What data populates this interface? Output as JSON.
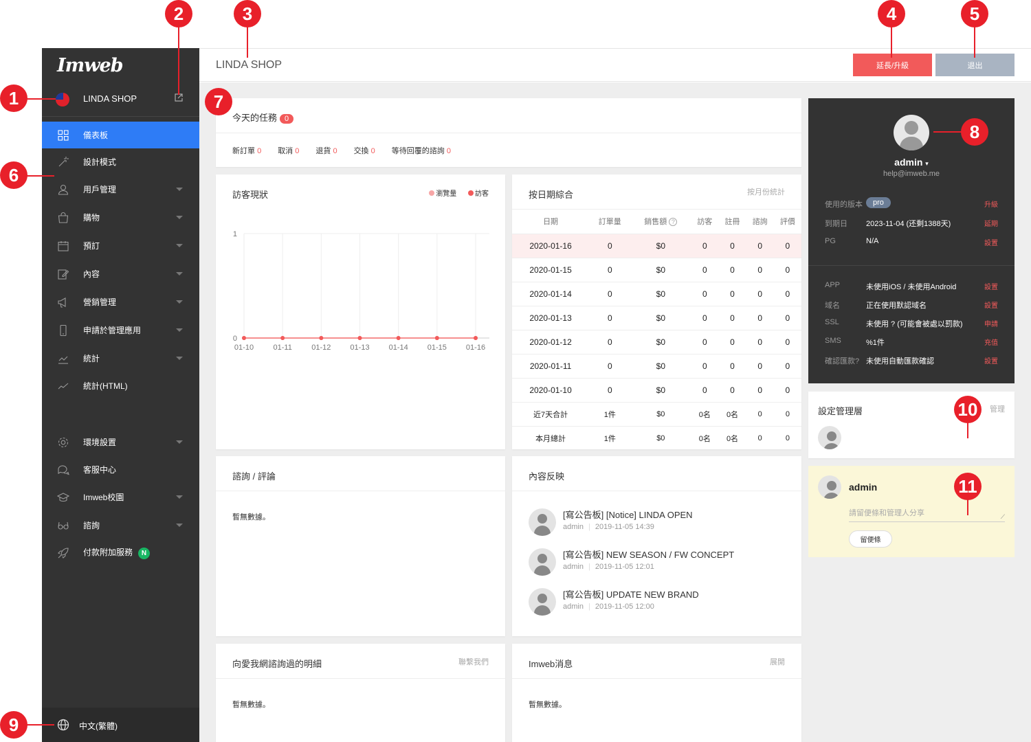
{
  "sidebar": {
    "logo": "Imweb",
    "shop_name": "LINDA SHOP",
    "items": [
      {
        "label": "儀表板",
        "icon": "dashboard-icon",
        "active": true,
        "caret": false
      },
      {
        "label": "設計模式",
        "icon": "magic-wand-icon",
        "active": false,
        "caret": false
      },
      {
        "label": "用戶管理",
        "icon": "user-icon",
        "active": false,
        "caret": true
      },
      {
        "label": "購物",
        "icon": "shopping-bag-icon",
        "active": false,
        "caret": true
      },
      {
        "label": "預訂",
        "icon": "calendar-icon",
        "active": false,
        "caret": true
      },
      {
        "label": "內容",
        "icon": "edit-icon",
        "active": false,
        "caret": true
      },
      {
        "label": "營銷管理",
        "icon": "megaphone-icon",
        "active": false,
        "caret": true
      },
      {
        "label": "申請於管理應用",
        "icon": "mobile-icon",
        "active": false,
        "caret": true
      },
      {
        "label": "統計",
        "icon": "chart-icon",
        "active": false,
        "caret": true
      },
      {
        "label": "統計(HTML)",
        "icon": "trend-icon",
        "active": false,
        "caret": false
      },
      {
        "label": "環境設置",
        "icon": "gear-icon",
        "active": false,
        "caret": true
      },
      {
        "label": "客服中心",
        "icon": "chat-icon",
        "active": false,
        "caret": false
      },
      {
        "label": "Imweb校園",
        "icon": "graduation-cap-icon",
        "active": false,
        "caret": true
      },
      {
        "label": "諮詢",
        "icon": "glasses-icon",
        "active": false,
        "caret": true
      },
      {
        "label": "付款附加服務",
        "icon": "rocket-icon",
        "active": false,
        "caret": false,
        "badge": "N"
      }
    ],
    "language": "中文(繁體)"
  },
  "topbar": {
    "title": "LINDA SHOP",
    "extend_button": "延長/升級",
    "logout_button": "退出"
  },
  "tasks": {
    "title": "今天的任務",
    "count": "0",
    "items": [
      {
        "label": "新訂單",
        "value": "0"
      },
      {
        "label": "取消",
        "value": "0"
      },
      {
        "label": "退貨",
        "value": "0"
      },
      {
        "label": "交換",
        "value": "0"
      },
      {
        "label": "等待回覆的諮詢",
        "value": "0"
      }
    ]
  },
  "visitors": {
    "title": "訪客現狀",
    "legend_pageviews": "瀏覽量",
    "legend_visitors": "訪客"
  },
  "chart_data": {
    "type": "line",
    "title": "訪客現狀",
    "x": [
      "01-10",
      "01-11",
      "01-12",
      "01-13",
      "01-14",
      "01-15",
      "01-16"
    ],
    "ylim": [
      0,
      1
    ],
    "yticks": [
      "0",
      "1"
    ],
    "series": [
      {
        "name": "瀏覽量",
        "values": [
          0,
          0,
          0,
          0,
          0,
          0,
          0
        ],
        "color": "#f7a6a6"
      },
      {
        "name": "訪客",
        "values": [
          0,
          0,
          0,
          0,
          0,
          0,
          0
        ],
        "color": "#f25a5a"
      }
    ],
    "legend": "top-right",
    "grid": true
  },
  "daily": {
    "title": "按日期綜合",
    "link": "按月份統計",
    "headers": [
      "日期",
      "訂單量",
      "銷售額",
      "訪客",
      "註冊",
      "諮詢",
      "評價"
    ],
    "rows": [
      [
        "2020-01-16",
        "0",
        "$0",
        "0",
        "0",
        "0",
        "0"
      ],
      [
        "2020-01-15",
        "0",
        "$0",
        "0",
        "0",
        "0",
        "0"
      ],
      [
        "2020-01-14",
        "0",
        "$0",
        "0",
        "0",
        "0",
        "0"
      ],
      [
        "2020-01-13",
        "0",
        "$0",
        "0",
        "0",
        "0",
        "0"
      ],
      [
        "2020-01-12",
        "0",
        "$0",
        "0",
        "0",
        "0",
        "0"
      ],
      [
        "2020-01-11",
        "0",
        "$0",
        "0",
        "0",
        "0",
        "0"
      ],
      [
        "2020-01-10",
        "0",
        "$0",
        "0",
        "0",
        "0",
        "0"
      ],
      [
        "近7天合計",
        "1件",
        "$0",
        "0名",
        "0名",
        "0",
        "0"
      ],
      [
        "本月總計",
        "1件",
        "$0",
        "0名",
        "0名",
        "0",
        "0"
      ]
    ]
  },
  "inquiry": {
    "title": "諮詢 / 評論",
    "empty": "暫無數據。"
  },
  "content": {
    "title": "內容反映",
    "items": [
      {
        "title": "[寫公告板] [Notice] LINDA OPEN",
        "author": "admin",
        "date": "2019-11-05 14:39"
      },
      {
        "title": "[寫公告板] NEW SEASON / FW CONCEPT",
        "author": "admin",
        "date": "2019-11-05 12:01"
      },
      {
        "title": "[寫公告板] UPDATE NEW BRAND",
        "author": "admin",
        "date": "2019-11-05 12:00"
      }
    ]
  },
  "contact": {
    "title": "向愛我網諮詢過的明細",
    "link": "聯繫我們",
    "empty": "暫無數據。"
  },
  "news": {
    "title": "Imweb消息",
    "link": "展開",
    "empty": "暫無數據。"
  },
  "profile": {
    "name": "admin",
    "email": "help@imweb.me",
    "rows1": [
      {
        "key": "使用的版本",
        "value": "pro",
        "action": "升級"
      },
      {
        "key": "到期日",
        "value": "2023-11-04 (还剩1388天)",
        "action": "延期"
      },
      {
        "key": "PG",
        "value": "N/A",
        "action": "設置"
      }
    ],
    "rows2": [
      {
        "key": "APP",
        "value": "未使用iOS / 未使用Android",
        "action": "設置"
      },
      {
        "key": "域名",
        "value": "正在使用默認域名",
        "action": "設置"
      },
      {
        "key": "SSL",
        "value": "未使用 ? (可能會被處以罰款)",
        "action": "申請"
      },
      {
        "key": "SMS",
        "value": "%1件",
        "action": "充值"
      },
      {
        "key": "確認匯款?",
        "value": "未使用自動匯款確認",
        "action": "設置"
      }
    ]
  },
  "managers": {
    "title": "設定管理層",
    "link": "管理"
  },
  "memo": {
    "name": "admin",
    "placeholder": "請留便條和管理人分享",
    "button": "留便條"
  },
  "callouts": [
    "1",
    "2",
    "3",
    "4",
    "5",
    "6",
    "7",
    "8",
    "9",
    "10",
    "11"
  ]
}
